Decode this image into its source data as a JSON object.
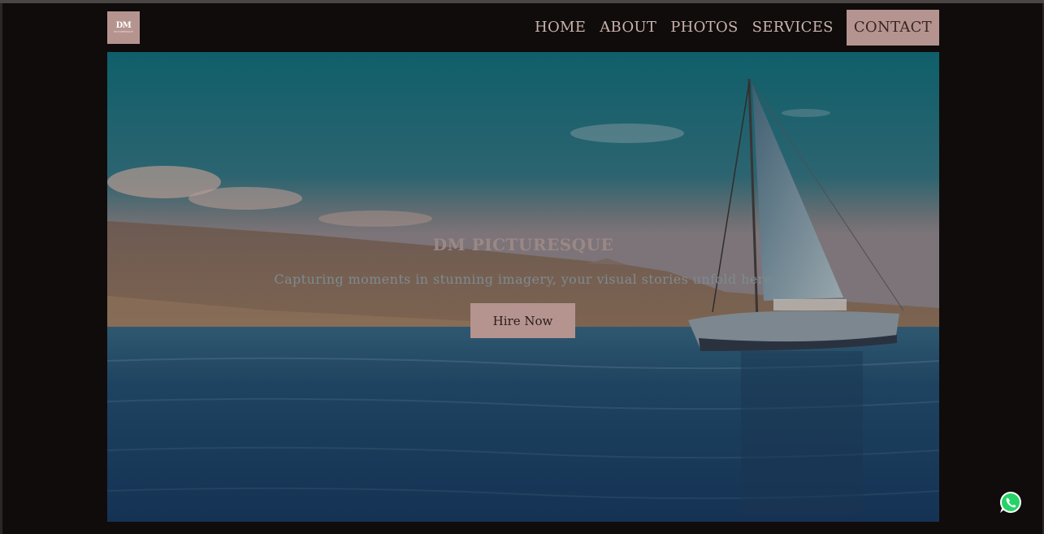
{
  "brand": {
    "logo_text": "DM",
    "logo_subtext": "PICTURESQUE"
  },
  "nav": {
    "items": [
      "HOME",
      "ABOUT",
      "PHOTOS",
      "SERVICES",
      "CONTACT"
    ]
  },
  "hero": {
    "title": "DM PICTURESQUE",
    "subtitle": "Capturing moments in stunning imagery, your visual stories unfold here",
    "cta_label": "Hire Now"
  },
  "colors": {
    "background": "#100c0b",
    "accent": "#b59490",
    "nav_text": "#c9b3ad"
  },
  "icons": {
    "floating_chat": "whatsapp-icon"
  }
}
